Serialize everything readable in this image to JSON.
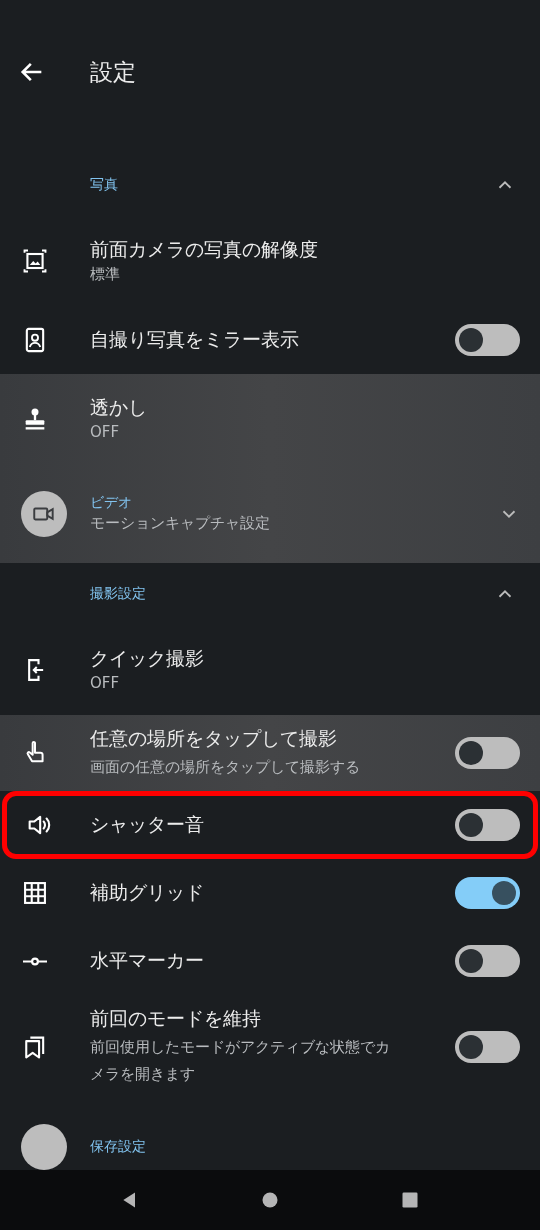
{
  "header": {
    "title": "設定"
  },
  "rows": [
    {
      "kind": "section",
      "title": "写真",
      "expanded": true
    },
    {
      "kind": "value",
      "title": "前面カメラの写真の解像度",
      "value": "標準",
      "shaded": false
    },
    {
      "kind": "toggle",
      "title": "自撮り写真をミラー表示",
      "on": false,
      "shaded": false,
      "highlighted": false
    },
    {
      "kind": "value",
      "title": "透かし",
      "value": "OFF",
      "shaded": true
    },
    {
      "kind": "group",
      "title": "ビデオ",
      "subtitle": "モーションキャプチャ設定",
      "expanded": false,
      "shaded": true
    },
    {
      "kind": "section",
      "title": "撮影設定",
      "expanded": true
    },
    {
      "kind": "value",
      "title": "クイック撮影",
      "value": "OFF",
      "shaded": false
    },
    {
      "kind": "toggle",
      "title": "任意の場所をタップして撮影",
      "subtitle": "画面の任意の場所をタップして撮影する",
      "on": false,
      "shaded": true,
      "highlighted": false
    },
    {
      "kind": "toggle",
      "title": "シャッター音",
      "on": false,
      "shaded": false,
      "highlighted": true
    },
    {
      "kind": "toggle",
      "title": "補助グリッド",
      "on": true,
      "shaded": false,
      "highlighted": false
    },
    {
      "kind": "toggle",
      "title": "水平マーカー",
      "on": false,
      "shaded": false,
      "highlighted": false
    },
    {
      "kind": "toggle",
      "title": "前回のモードを維持",
      "subtitle": "前回使用したモードがアクティブな状態でカメラを開きます",
      "on": false,
      "shaded": false,
      "highlighted": false
    },
    {
      "kind": "group",
      "title": "保存設定",
      "shaded": false
    }
  ]
}
